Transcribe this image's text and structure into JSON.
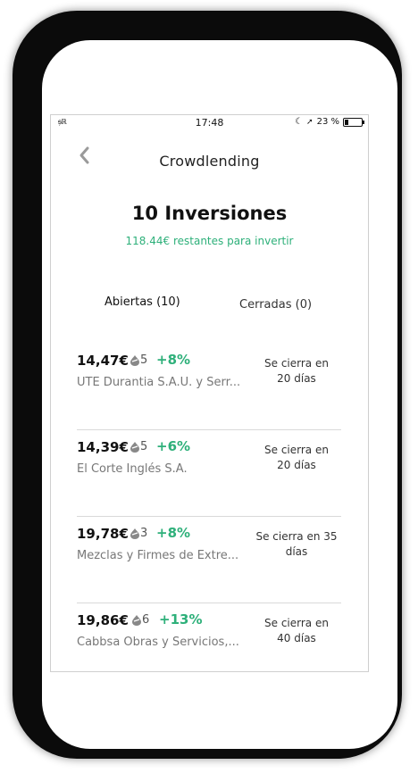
{
  "status_bar": {
    "carrier": "ᵴ᷊ℝ",
    "time": "17:48",
    "battery": "23 %",
    "battery_level": 0.23
  },
  "header": {
    "title": "Crowdlending"
  },
  "summary": {
    "title": "10 Inversiones",
    "remaining": "118.44€ restantes para invertir"
  },
  "tabs": [
    {
      "label": "Abiertas (10)",
      "selected": true
    },
    {
      "label": "Cerradas (0)",
      "selected": false
    }
  ],
  "investments": [
    {
      "amount": "14,47€",
      "rating": "5",
      "return": "+8%",
      "company": "UTE Durantia S.A.U. y Serr...",
      "close_line1": "Se cierra en",
      "close_line2": "20 días"
    },
    {
      "amount": "14,39€",
      "rating": "5",
      "return": "+6%",
      "company": "El Corte Inglés S.A.",
      "close_line1": "Se cierra en",
      "close_line2": "20 días"
    },
    {
      "amount": "19,78€",
      "rating": "3",
      "return": "+8%",
      "company": "Mezclas y Firmes de Extre...",
      "close_line1": "Se cierra en 35",
      "close_line2": "días"
    },
    {
      "amount": "19,86€",
      "rating": "6",
      "return": "+13%",
      "company": "Cabbsa Obras y Servicios,...",
      "close_line1": "Se cierra en",
      "close_line2": "40 días"
    }
  ],
  "colors": {
    "accent": "#2eb07a",
    "text": "#111111",
    "muted": "#777777"
  }
}
